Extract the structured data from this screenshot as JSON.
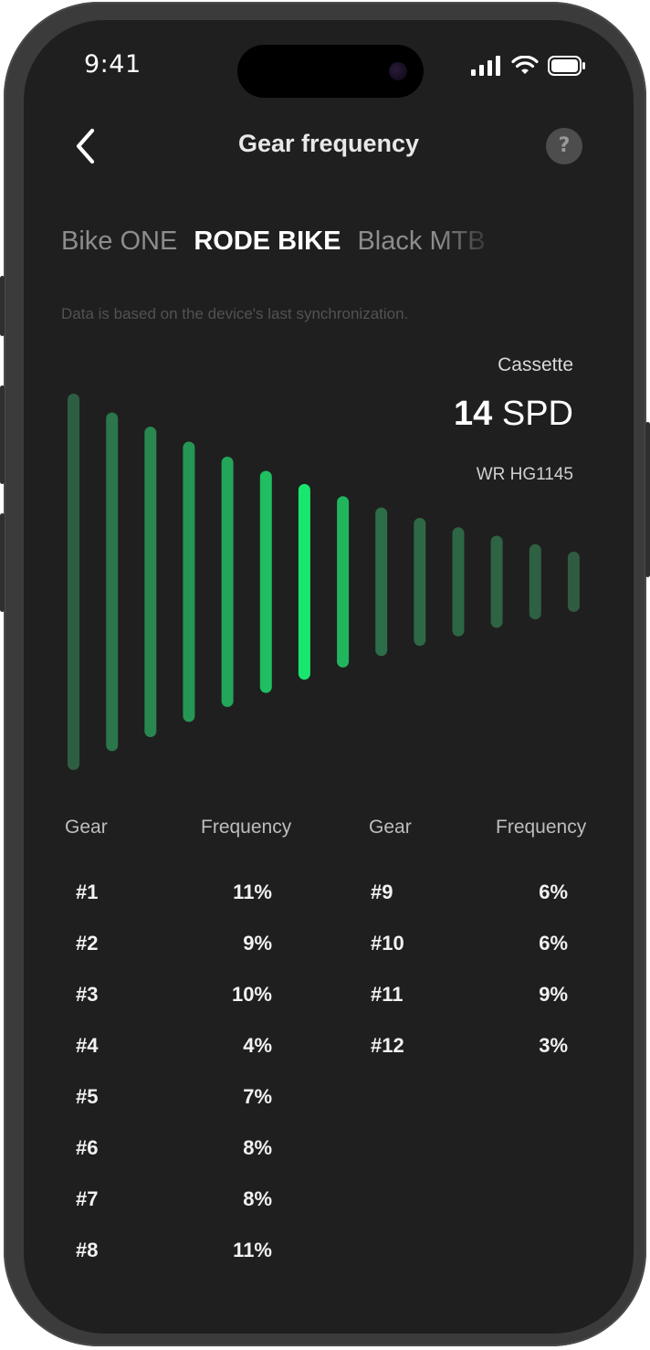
{
  "status_bar": {
    "time": "9:41",
    "icons": [
      "signal-icon",
      "wifi-icon",
      "battery-icon"
    ]
  },
  "header": {
    "back_icon": "chevron-left-icon",
    "title": "Gear frequency",
    "help_label": "?"
  },
  "tabs": [
    {
      "label": "Bike ONE",
      "active": false
    },
    {
      "label": "RODE BIKE",
      "active": true
    },
    {
      "label": "Black MTB",
      "active": false
    }
  ],
  "sync_note": "Data is based on the device's last synchronization.",
  "cassette": {
    "label": "Cassette",
    "speed_number": "14",
    "speed_unit": "SPD",
    "model": "WR HG1145"
  },
  "colors": {
    "background": "#1f1f1f",
    "accent": "#19e06a",
    "text": "#ffffff",
    "muted": "#8d8d8d"
  },
  "chart_data": {
    "type": "bar",
    "orientation": "vertical-centered",
    "bar_count": 14,
    "highlighted_index": 6,
    "intensity": [
      0.15,
      0.3,
      0.4,
      0.5,
      0.6,
      0.75,
      1.0,
      0.7,
      0.25,
      0.22,
      0.2,
      0.18,
      0.16,
      0.14
    ],
    "relative_size": [
      1.0,
      0.9,
      0.825,
      0.745,
      0.665,
      0.59,
      0.52,
      0.455,
      0.395,
      0.34,
      0.29,
      0.245,
      0.2,
      0.16
    ]
  },
  "table": {
    "headers": {
      "gear": "Gear",
      "frequency": "Frequency"
    },
    "left": [
      {
        "gear": "#1",
        "frequency": "11%"
      },
      {
        "gear": "#2",
        "frequency": "9%"
      },
      {
        "gear": "#3",
        "frequency": "10%"
      },
      {
        "gear": "#4",
        "frequency": "4%"
      },
      {
        "gear": "#5",
        "frequency": "7%"
      },
      {
        "gear": "#6",
        "frequency": "8%"
      },
      {
        "gear": "#7",
        "frequency": "8%"
      },
      {
        "gear": "#8",
        "frequency": "11%"
      }
    ],
    "right": [
      {
        "gear": "#9",
        "frequency": "6%"
      },
      {
        "gear": "#10",
        "frequency": "6%"
      },
      {
        "gear": "#11",
        "frequency": "9%"
      },
      {
        "gear": "#12",
        "frequency": "3%"
      }
    ]
  }
}
